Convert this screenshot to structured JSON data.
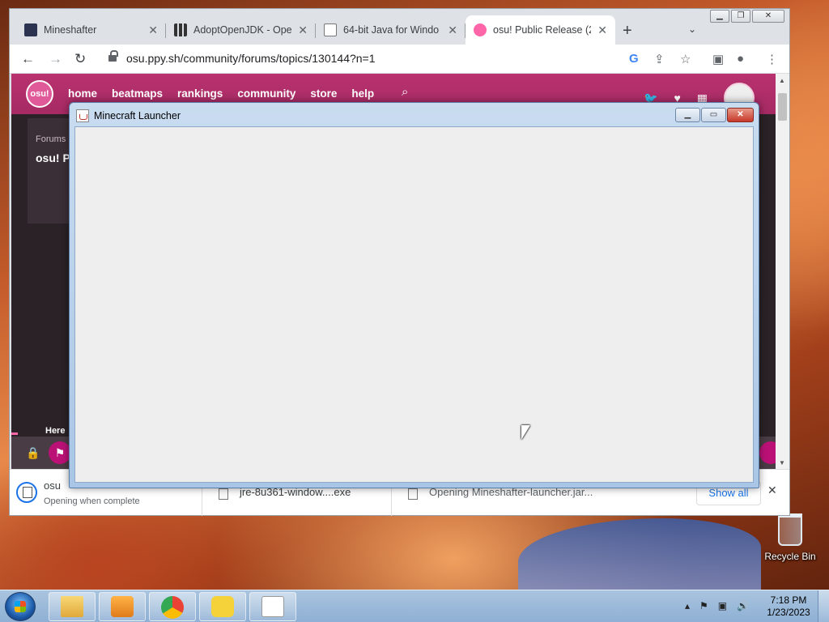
{
  "desktop": {
    "recycle_bin_label": "Recycle Bin"
  },
  "chrome": {
    "tabs": [
      {
        "title": "Mineshafter",
        "favicon": "mineshafter-icon",
        "active": false
      },
      {
        "title": "AdoptOpenJDK - Ope",
        "favicon": "grid-icon",
        "active": false
      },
      {
        "title": "64-bit Java for Windo",
        "favicon": "java-icon",
        "active": false
      },
      {
        "title": "osu! Public Release (2",
        "favicon": "osu-icon",
        "active": true
      }
    ],
    "new_tab_label": "+",
    "url": "osu.ppy.sh/community/forums/topics/130144?n=1"
  },
  "osu": {
    "logo_text": "osu!",
    "nav": [
      "home",
      "beatmaps",
      "rankings",
      "community",
      "store",
      "help"
    ],
    "forums_label": "Forums",
    "title_partial": "osu! P",
    "here_text": "Here"
  },
  "downloads": {
    "items": [
      {
        "name": "osu",
        "status": "Opening when complete"
      },
      {
        "name": "jre-8u361-window....exe",
        "status": ""
      },
      {
        "name": "Opening Mineshafter-launcher.jar...",
        "status": ""
      }
    ],
    "show_all": "Show all"
  },
  "launcher": {
    "title": "Minecraft Launcher"
  },
  "taskbar": {
    "time": "7:18 PM",
    "date": "1/23/2023"
  },
  "colors": {
    "osu_pink": "#bb1177",
    "chrome_blue": "#1a73e8"
  }
}
